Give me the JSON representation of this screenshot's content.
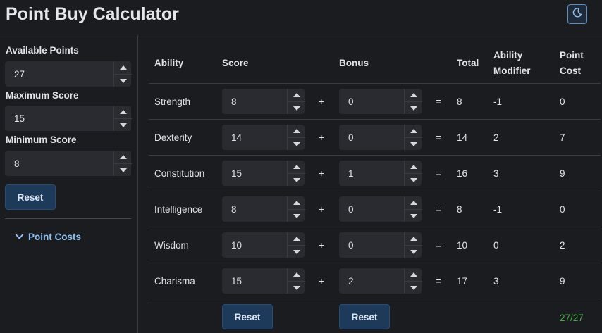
{
  "app": {
    "title": "Point Buy Calculator",
    "theme_icon": "moon-icon"
  },
  "sidebar": {
    "available_points": {
      "label": "Available Points",
      "value": "27"
    },
    "maximum_score": {
      "label": "Maximum Score",
      "value": "15"
    },
    "minimum_score": {
      "label": "Minimum Score",
      "value": "8"
    },
    "reset_label": "Reset",
    "point_costs_label": "Point Costs"
  },
  "table": {
    "headers": {
      "ability": "Ability",
      "score": "Score",
      "bonus": "Bonus",
      "total": "Total",
      "modifier_line1": "Ability",
      "modifier_line2": "Modifier",
      "cost_line1": "Point",
      "cost_line2": "Cost"
    },
    "plus": "+",
    "equals": "=",
    "rows": [
      {
        "ability": "Strength",
        "score": "8",
        "bonus": "0",
        "total": "8",
        "modifier": "-1",
        "cost": "0"
      },
      {
        "ability": "Dexterity",
        "score": "14",
        "bonus": "0",
        "total": "14",
        "modifier": "2",
        "cost": "7"
      },
      {
        "ability": "Constitution",
        "score": "15",
        "bonus": "1",
        "total": "16",
        "modifier": "3",
        "cost": "9"
      },
      {
        "ability": "Intelligence",
        "score": "8",
        "bonus": "0",
        "total": "8",
        "modifier": "-1",
        "cost": "0"
      },
      {
        "ability": "Wisdom",
        "score": "10",
        "bonus": "0",
        "total": "10",
        "modifier": "0",
        "cost": "2"
      },
      {
        "ability": "Charisma",
        "score": "15",
        "bonus": "2",
        "total": "17",
        "modifier": "3",
        "cost": "9"
      }
    ],
    "reset_scores_label": "Reset",
    "reset_bonus_label": "Reset",
    "points_used": "27/27"
  },
  "colors": {
    "background": "#1b1c20",
    "accent": "#1e3a5a",
    "link": "#8fc0f0",
    "success": "#3fae3f"
  }
}
